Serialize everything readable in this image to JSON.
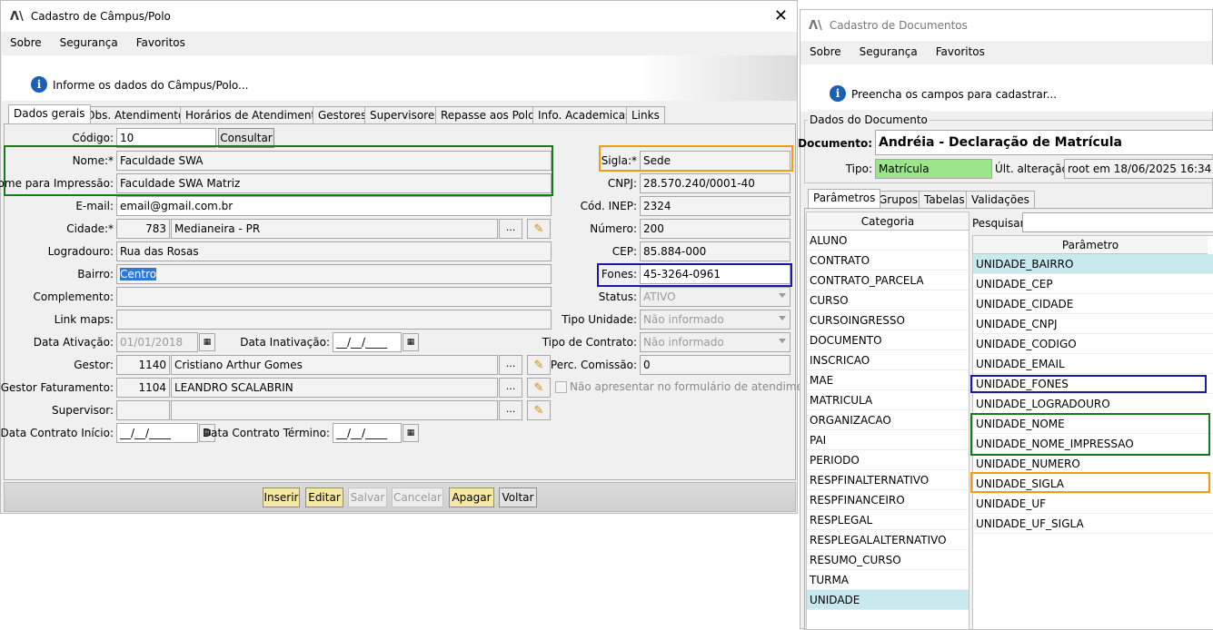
{
  "left": {
    "title": "Cadastro de Câmpus/Polo",
    "menu": [
      "Sobre",
      "Segurança",
      "Favoritos"
    ],
    "info": "Informe os dados do Câmpus/Polo...",
    "tabs": [
      "Dados gerais",
      "Obs. Atendimento",
      "Horários de Atendimento",
      "Gestores",
      "Supervisores",
      "Repasse aos Polos",
      "Info. Academicas",
      "Links"
    ],
    "labels": {
      "codigo": "Código:",
      "nome": "Nome:*",
      "nome_impressao": "Nome para Impressão:",
      "email": "E-mail:",
      "cidade": "Cidade:*",
      "logradouro": "Logradouro:",
      "bairro": "Bairro:",
      "complemento": "Complemento:",
      "link_maps": "Link maps:",
      "data_ativacao": "Data Ativação:",
      "data_inativacao": "Data Inativação:",
      "gestor": "Gestor:",
      "gestor_faturamento": "Gestor Faturamento:",
      "supervisor": "Supervisor:",
      "data_contrato_inicio": "Data Contrato Início:",
      "data_contrato_termino": "Data Contrato Término:",
      "sigla": "Sigla:*",
      "cnpj": "CNPJ:",
      "cod_inep": "Cód. INEP:",
      "numero": "Número:",
      "cep": "CEP:",
      "fones": "Fones:",
      "status": "Status:",
      "tipo_unidade": "Tipo Unidade:",
      "tipo_contrato": "Tipo de Contrato:",
      "perc_comissao": "Perc. Comissão:"
    },
    "values": {
      "codigo": "10",
      "nome": "Faculdade SWA",
      "nome_impressao": "Faculdade SWA Matriz",
      "email": "email@gmail.com.br",
      "cidade_code": "783",
      "cidade": "Medianeira - PR",
      "logradouro": "Rua das Rosas",
      "bairro": "Centro",
      "complemento": "",
      "link_maps": "",
      "data_ativacao": "01/01/2018",
      "data_inativacao": "__/__/____",
      "gestor_code": "1140",
      "gestor": "Cristiano Arthur Gomes",
      "gestor_fat_code": "1104",
      "gestor_fat": "LEANDRO SCALABRIN",
      "supervisor_code": "",
      "supervisor": "",
      "data_contrato_inicio": "__/__/____",
      "data_contrato_termino": "__/__/____",
      "sigla": "Sede",
      "cnpj": "28.570.240/0001-40",
      "cod_inep": "2324",
      "numero": "200",
      "cep": "85.884-000",
      "fones": "45-3264-0961",
      "status": "ATIVO",
      "tipo_unidade": "Não informado",
      "tipo_contrato": "Não informado",
      "perc_comissao": "0"
    },
    "consultar": "Consultar",
    "dots": "...",
    "checkbox_label": "Não apresentar no formulário de atendimento",
    "buttons": [
      "Inserir",
      "Editar",
      "Salvar",
      "Cancelar",
      "Apagar",
      "Voltar"
    ]
  },
  "right": {
    "title": "Cadastro de Documentos",
    "menu": [
      "Sobre",
      "Segurança",
      "Favoritos"
    ],
    "info": "Preencha os campos para cadastrar...",
    "group": "Dados do Documento",
    "documento_label": "Documento:",
    "documento": "Andréia - Declaração de Matrícula",
    "tipo_label": "Tipo:",
    "tipo": "Matrícula",
    "ult_label": "Últ. alteração:",
    "ult": "root em 18/06/2025 16:34",
    "tabs": [
      "Parâmetros",
      "Grupos",
      "Tabelas",
      "Validações"
    ],
    "categoria_header": "Categoria",
    "categorias": [
      "ALUNO",
      "CONTRATO",
      "CONTRATO_PARCELA",
      "CURSO",
      "CURSOINGRESSO",
      "DOCUMENTO",
      "INSCRICAO",
      "MAE",
      "MATRICULA",
      "ORGANIZACAO",
      "PAI",
      "PERIODO",
      "RESPFINALTERNATIVO",
      "RESPFINANCEIRO",
      "RESPLEGAL",
      "RESPLEGALALTERNATIVO",
      "RESUMO_CURSO",
      "TURMA",
      "UNIDADE"
    ],
    "pesquisar": "Pesquisar:",
    "parametro_header": "Parâmetro",
    "parametros": [
      "UNIDADE_BAIRRO",
      "UNIDADE_CEP",
      "UNIDADE_CIDADE",
      "UNIDADE_CNPJ",
      "UNIDADE_CODIGO",
      "UNIDADE_EMAIL",
      "UNIDADE_FONES",
      "UNIDADE_LOGRADOURO",
      "UNIDADE_NOME",
      "UNIDADE_NOME_IMPRESSAO",
      "UNIDADE_NUMERO",
      "UNIDADE_SIGLA",
      "UNIDADE_UF",
      "UNIDADE_UF_SIGLA"
    ]
  },
  "colors": {
    "green": "#1a7a1a",
    "orange": "#f39c12",
    "blue": "#1a1aa0",
    "selection": "#c8e9ee",
    "tipo_bg": "#9be58a"
  }
}
